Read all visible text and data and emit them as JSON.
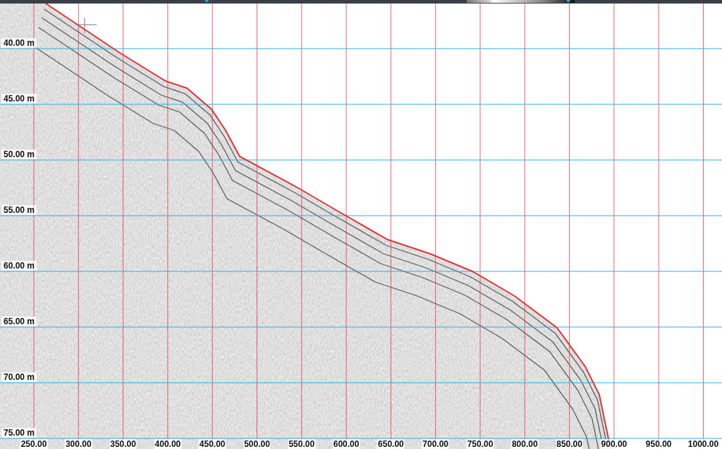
{
  "depth_axis": {
    "labels": [
      "40.00 m",
      "45.00 m",
      "50.00 m",
      "55.00 m",
      "60.00 m",
      "65.00 m",
      "70.00 m",
      "75.00 m"
    ]
  },
  "distance_axis": {
    "labels": [
      "250.00",
      "300.00",
      "350.00",
      "400.00",
      "450.00",
      "500.00",
      "550.00",
      "600.00",
      "650.00",
      "700.00",
      "750.00",
      "800.00",
      "850.00",
      "900.00",
      "950.00",
      "1000.00"
    ]
  }
}
